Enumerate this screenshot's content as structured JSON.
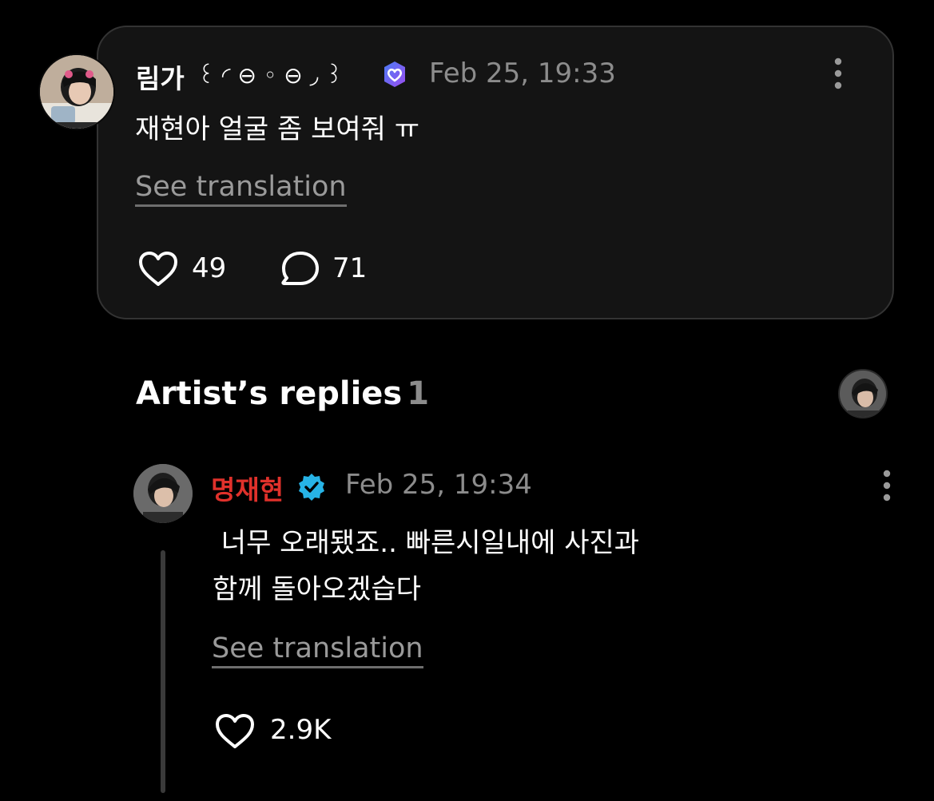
{
  "post": {
    "user_name": "림가",
    "name_decoration": "꒰ ◜ ⊖ ◦ ⊖ ◞ ꒱",
    "timestamp": "Feb 25, 19:33",
    "body": "재현아 얼굴 좀 보여줘 ㅠ",
    "see_translation": "See translation",
    "like_count": "49",
    "comment_count": "71",
    "icons": {
      "badge": "purple-verified-heart-badge-icon",
      "more": "more-vertical-icon",
      "like": "heart-outline-icon",
      "comment": "comment-bubble-icon"
    }
  },
  "artist_replies": {
    "heading": "Artist’s replies",
    "count": "1",
    "reply": {
      "user_name": "명재현",
      "timestamp": "Feb 25, 19:34",
      "body_line1": " 너무 오래됐죠.. 빠른시일내에 사진과",
      "body_line2": "함께 돌아오겠습다",
      "see_translation": "See translation",
      "like_count": "2.9K",
      "icons": {
        "badge": "blue-verified-check-badge-icon",
        "more": "more-vertical-icon",
        "like": "heart-outline-icon"
      }
    }
  },
  "colors": {
    "background": "#000000",
    "card": "#141414",
    "card_border": "#333333",
    "artist_name": "#e0312b",
    "muted_text": "#8c8c8c",
    "verified_blue": "#27b3e6",
    "badge_purple": "#7b5cf0"
  }
}
